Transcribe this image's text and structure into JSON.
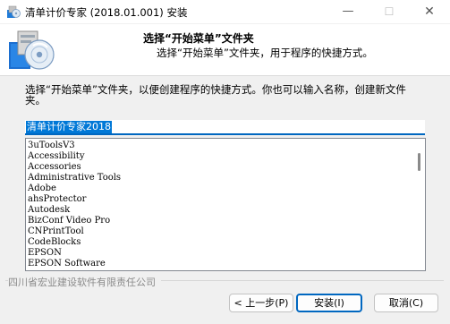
{
  "window": {
    "title": "清单计价专家 (2018.01.001) 安装",
    "min_glyph": "—",
    "max_glyph": "☐",
    "close_glyph": "✕"
  },
  "header": {
    "title": "选择“开始菜单”文件夹",
    "subtitle": "选择“开始菜单”文件夹，用于程序的快捷方式。"
  },
  "instruction": "选择“开始菜单”文件夹，以便创建程序的快捷方式。你也可以输入名称，创建新文件夹。",
  "folder_input": {
    "value": "清单计价专家2018"
  },
  "folder_list": [
    "3uToolsV3",
    "Accessibility",
    "Accessories",
    "Administrative Tools",
    "Adobe",
    "ahsProtector",
    "Autodesk",
    "BizConf Video Pro",
    "CNPrintTool",
    "CodeBlocks",
    "EPSON",
    "EPSON Software"
  ],
  "footer": {
    "brand": "四川省宏业建设软件有限责任公司",
    "back_label": "< 上一步(P)",
    "install_label": "安装(I)",
    "cancel_label": "取消(C)"
  }
}
